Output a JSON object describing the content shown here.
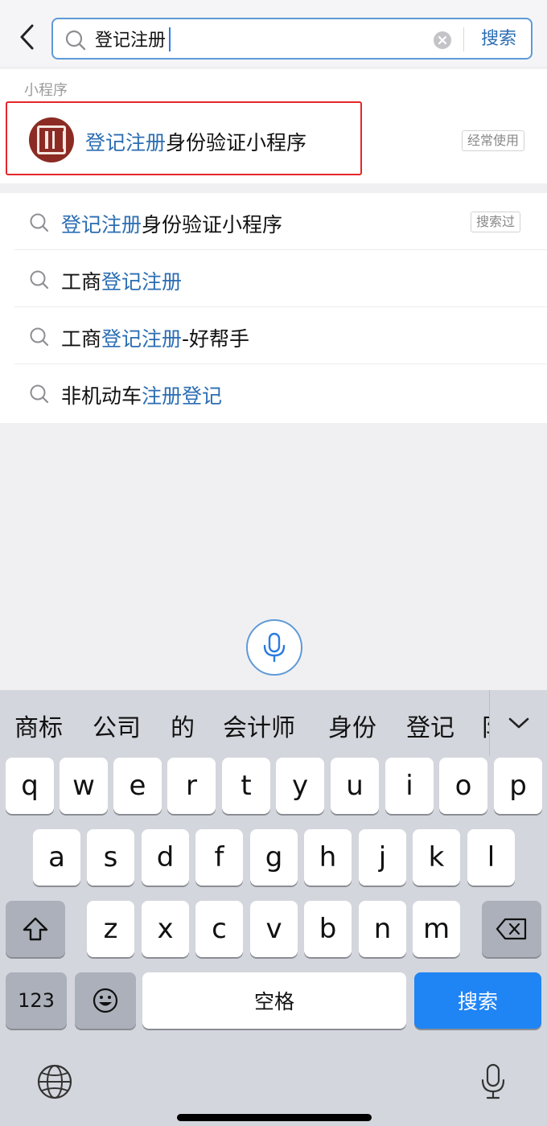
{
  "search": {
    "query": "登记注册",
    "button_label": "搜索"
  },
  "miniapp_section": {
    "label": "小程序",
    "item": {
      "name_highlight": "登记注册",
      "name_rest": "身份验证小程序",
      "badge": "经常使用"
    }
  },
  "suggestions": [
    {
      "pre": "",
      "hl": "登记注册",
      "post": "身份验证小程序",
      "badge": "搜索过"
    },
    {
      "pre": "工商",
      "hl": "登记注册",
      "post": "",
      "badge": ""
    },
    {
      "pre": "工商",
      "hl": "登记注册",
      "post": "-好帮手",
      "badge": ""
    },
    {
      "pre": "非机动车",
      "hl": "注册登记",
      "post": "",
      "badge": ""
    }
  ],
  "keyboard": {
    "candidates": [
      "商标",
      "公司",
      "的",
      "会计师",
      "身份",
      "登记",
      "阝"
    ],
    "row1": [
      "q",
      "w",
      "e",
      "r",
      "t",
      "y",
      "u",
      "i",
      "o",
      "p"
    ],
    "row2": [
      "a",
      "s",
      "d",
      "f",
      "g",
      "h",
      "j",
      "k",
      "l"
    ],
    "row3": [
      "z",
      "x",
      "c",
      "v",
      "b",
      "n",
      "m"
    ],
    "numbers_label": "123",
    "space_label": "空格",
    "search_label": "搜索"
  },
  "colors": {
    "accent": "#2b6db3",
    "frame": "#e4262b",
    "key_blue": "#1f84f4",
    "logo": "#8c2b24"
  },
  "icons": {
    "back": "chevron-left-icon",
    "search": "magnifier-icon",
    "clear": "clear-circle-icon",
    "voice": "microphone-icon",
    "collapse": "chevron-down-icon",
    "shift": "shift-arrow-icon",
    "delete": "backspace-icon",
    "emoji": "smiley-icon",
    "globe": "globe-icon",
    "dictation": "microphone-icon"
  }
}
